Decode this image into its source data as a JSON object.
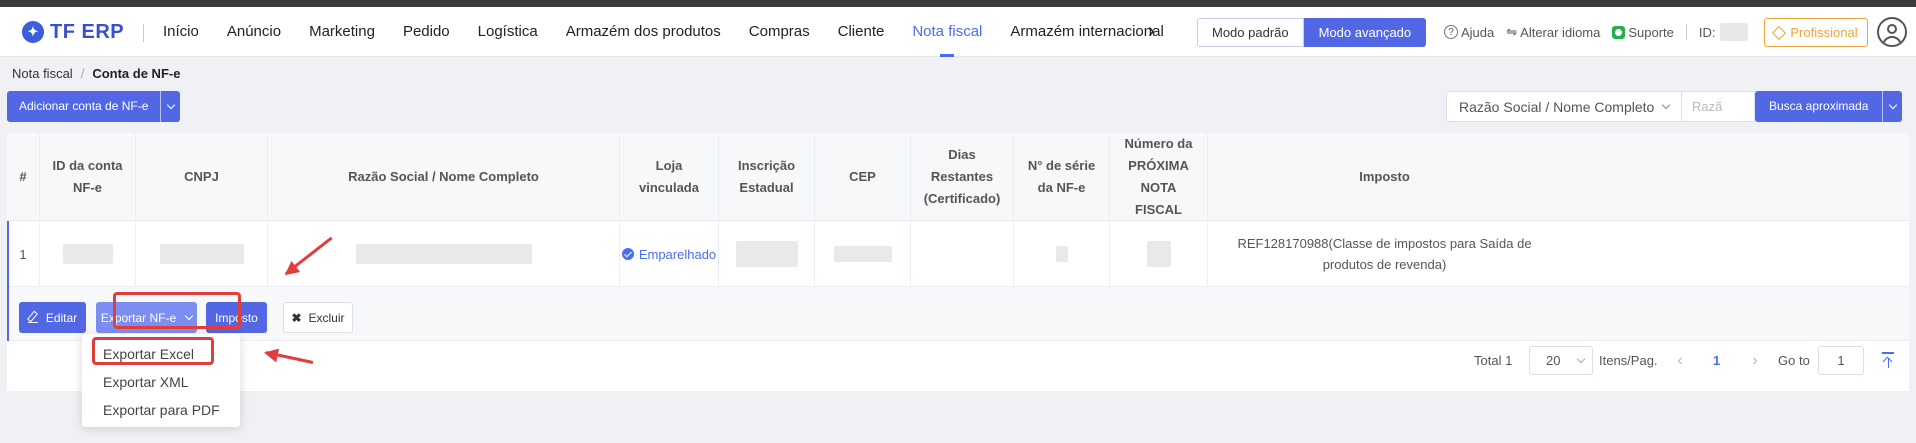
{
  "nav": {
    "logo_text": "TF ERP",
    "items": [
      {
        "label": "Início"
      },
      {
        "label": "Anúncio"
      },
      {
        "label": "Marketing"
      },
      {
        "label": "Pedido"
      },
      {
        "label": "Logística"
      },
      {
        "label": "Armazém dos produtos"
      },
      {
        "label": "Compras"
      },
      {
        "label": "Cliente"
      },
      {
        "label": "Nota fiscal",
        "active": true
      },
      {
        "label": "Armazém internacional"
      }
    ],
    "more_icon": "chevron-right-icon",
    "mode_standard": "Modo padrão",
    "mode_advanced": "Modo avançado",
    "help": "Ajuda",
    "language": "Alterar idioma",
    "support": "Suporte",
    "id_label": "ID:",
    "plan": "Profissional"
  },
  "breadcrumb": {
    "parent": "Nota fiscal",
    "separator": "/",
    "current": "Conta de NF-e"
  },
  "toolbar": {
    "add_button": "Adicionar conta de NF-e",
    "search_field": "Razão Social / Nome Completo",
    "search_placeholder": "Razã",
    "search_button": "Busca aproximada"
  },
  "table": {
    "headers": [
      "#",
      "ID da conta NF-e",
      "CNPJ",
      "Razão Social / Nome Completo",
      "Loja vinculada",
      "Inscrição Estadual",
      "CEP",
      "Dias Restantes (Certificado)",
      "N° de série da NF-e",
      "Número da PRÓXIMA NOTA FISCAL",
      "Imposto"
    ],
    "row": {
      "index": "1",
      "linked_status": "Emparelhado",
      "imposto": "REF128170988(Classe de impostos para Saída de produtos de revenda)"
    }
  },
  "actions": {
    "edit": "Editar",
    "export": "Exportar NF-e",
    "tax": "Imposto",
    "delete": "Excluir"
  },
  "export_menu": {
    "items": [
      "Exportar Excel",
      "Exportar XML",
      "Exportar para PDF"
    ]
  },
  "pagination": {
    "total": "Total 1",
    "page_size": "20",
    "per_page_label": "Itens/Pag.",
    "current_page": "1",
    "goto_label": "Go to",
    "goto_value": "1"
  },
  "colors": {
    "accent": "#5167e3",
    "highlight": "#e23d3d",
    "pro": "#f0a43a"
  }
}
